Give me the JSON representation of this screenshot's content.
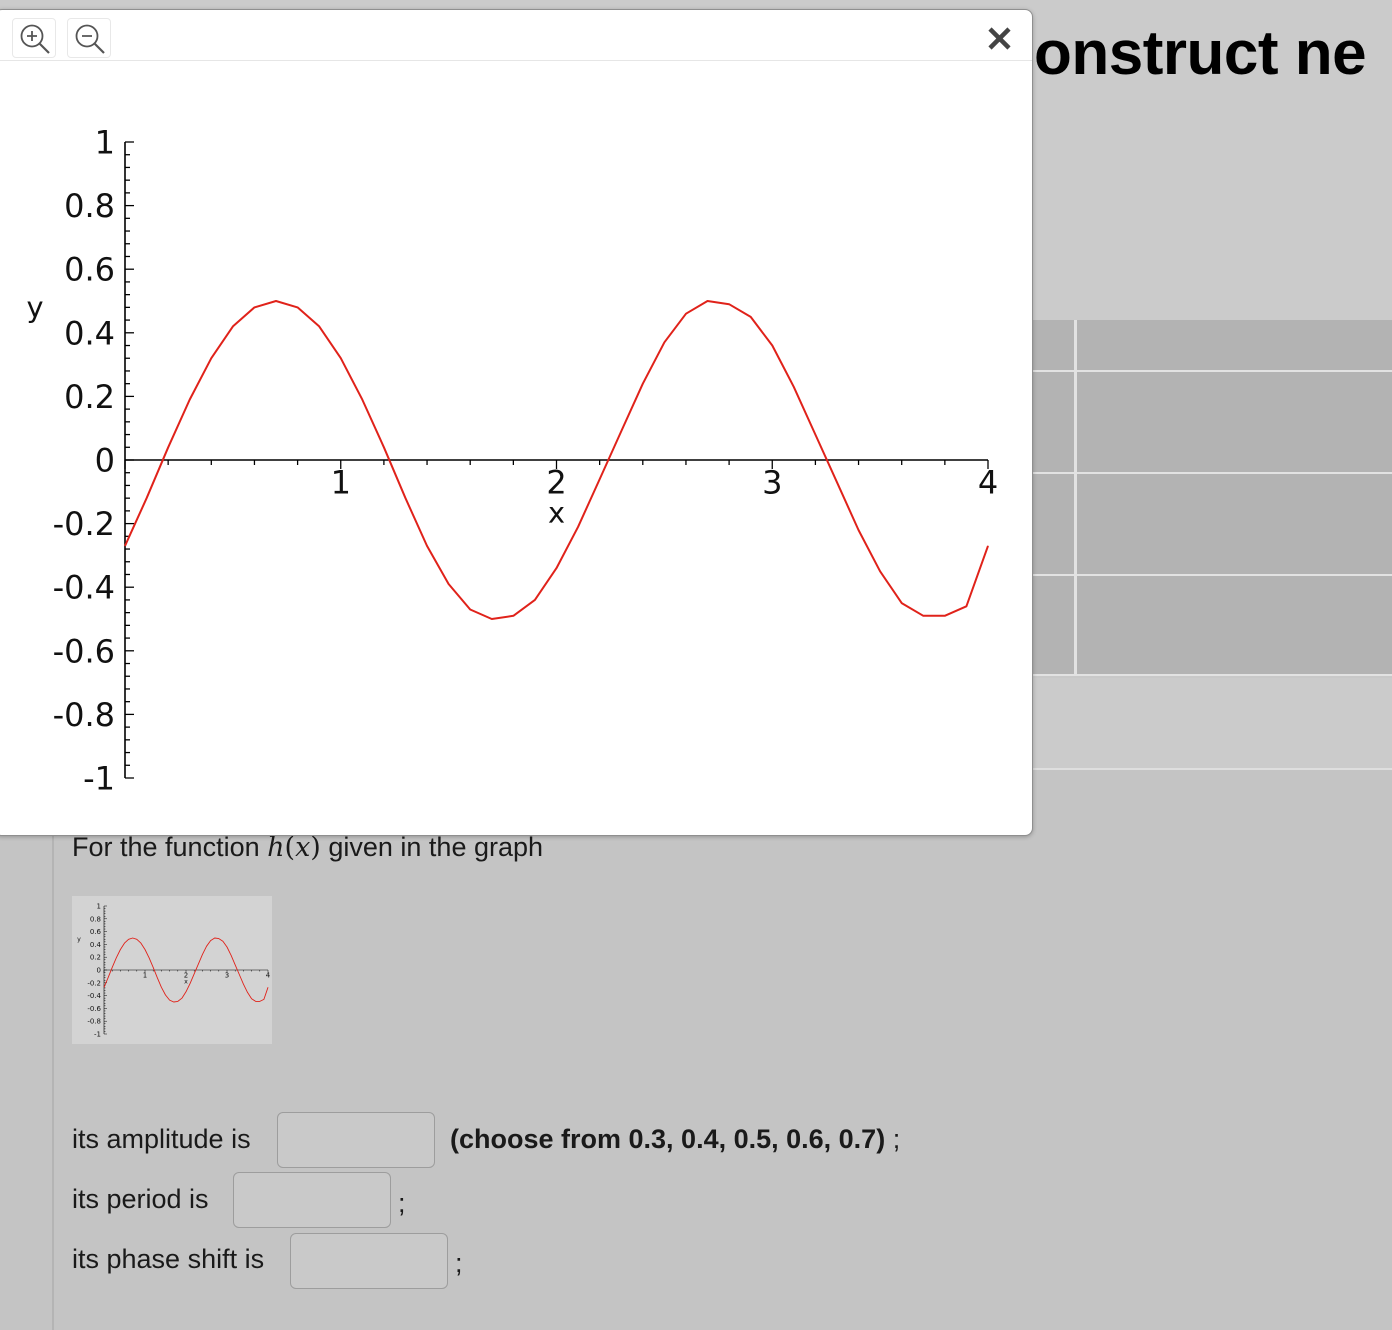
{
  "background": {
    "heading": "onstruct ne"
  },
  "popup": {
    "zoom_in_icon": "zoom-in-icon",
    "zoom_out_icon": "zoom-out-icon",
    "close_icon": "close-icon",
    "close_symbol": "×"
  },
  "question": {
    "intro_before": "For the function",
    "function_name": "h",
    "function_arg": "x",
    "intro_after": "given in the graph",
    "amplitude_label": "its amplitude is",
    "amplitude_hint": "(choose from 0.3, 0.4, 0.5, 0.6, 0.7)",
    "amplitude_value": "",
    "period_label": "its period is",
    "period_value": "",
    "phase_label": "its phase shift is",
    "phase_value": "",
    "semicolon": ";"
  },
  "chart_data": {
    "type": "line",
    "title": "",
    "xlabel": "x",
    "ylabel": "y",
    "xlim": [
      0,
      4
    ],
    "ylim": [
      -1,
      1
    ],
    "x_ticks": [
      "1",
      "2",
      "3",
      "4"
    ],
    "y_ticks": [
      "1",
      "0.8",
      "0.6",
      "0.4",
      "0.2",
      "0",
      "-0.2",
      "-0.4",
      "-0.6",
      "-0.8",
      "-1"
    ],
    "series": [
      {
        "color": "#e0221a",
        "x": [
          0.0,
          0.1,
          0.2,
          0.3,
          0.4,
          0.5,
          0.6,
          0.7,
          0.8,
          0.9,
          1.0,
          1.1,
          1.2,
          1.3,
          1.4,
          1.5,
          1.6,
          1.7,
          1.8,
          1.9,
          2.0,
          2.1,
          2.2,
          2.3,
          2.4,
          2.5,
          2.6,
          2.7,
          2.8,
          2.9,
          3.0,
          3.1,
          3.2,
          3.3,
          3.4,
          3.5,
          3.6,
          3.7,
          3.8,
          3.9,
          4.0
        ],
        "y": [
          -0.27,
          -0.12,
          0.04,
          0.19,
          0.32,
          0.42,
          0.48,
          0.5,
          0.48,
          0.42,
          0.32,
          0.19,
          0.04,
          -0.12,
          -0.27,
          -0.39,
          -0.47,
          -0.5,
          -0.49,
          -0.44,
          -0.34,
          -0.21,
          -0.06,
          0.09,
          0.24,
          0.37,
          0.46,
          0.5,
          0.49,
          0.45,
          0.36,
          0.23,
          0.08,
          -0.07,
          -0.22,
          -0.35,
          -0.45,
          -0.49,
          -0.49,
          -0.46,
          -0.27
        ]
      }
    ],
    "grid": false,
    "legend": "none"
  }
}
